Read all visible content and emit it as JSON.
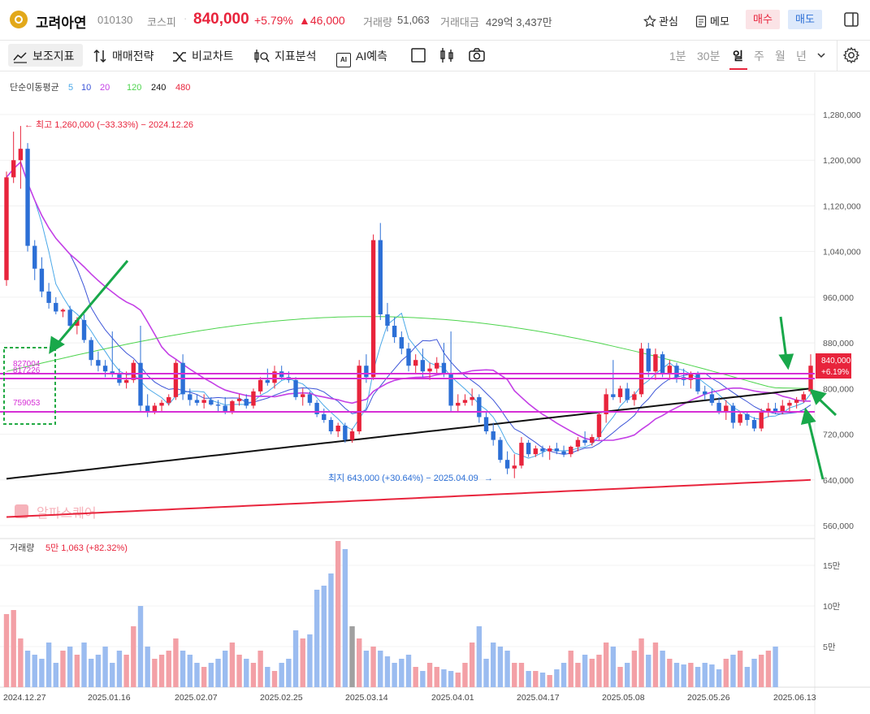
{
  "stock": {
    "name": "고려아연",
    "code": "010130",
    "market": "코스피",
    "price": "840,000",
    "change_pct": "+5.79%",
    "change_amt": "▲46,000",
    "volume_label": "거래량",
    "volume": "51,063",
    "amount_label": "거래대금",
    "amount": "429억 3,437만"
  },
  "header_actions": {
    "watch": "관심",
    "memo": "메모",
    "buy": "매수",
    "sell": "매도"
  },
  "toolbar": {
    "indicators": "보조지표",
    "strategy": "매매전략",
    "compare": "비교차트",
    "analysis": "지표분석",
    "ai": "AI예측",
    "ai_icon": "AI"
  },
  "periods": [
    "1분",
    "30분",
    "일",
    "주",
    "월",
    "년"
  ],
  "active_period": "일",
  "ma_legend": {
    "title": "단순이동평균",
    "items": [
      {
        "label": "5",
        "color": "#4aa8e8"
      },
      {
        "label": "10",
        "color": "#3d55d8"
      },
      {
        "label": "20",
        "color": "#c440e6"
      },
      {
        "label": "120",
        "color": "#4dd44d"
      },
      {
        "label": "240",
        "color": "#111111"
      },
      {
        "label": "480",
        "color": "#e8243c"
      }
    ]
  },
  "annotations": {
    "high": "최고 1,260,000 (−33.33%) − 2024.12.26",
    "low": "최지 643,000 (+30.64%) − 2025.04.09",
    "level_1": "827004",
    "level_2": "817226",
    "level_3": "759053",
    "watermark": "알파스퀘어"
  },
  "price_tag": {
    "price": "840,000",
    "change": "+6.19%"
  },
  "volume_legend": {
    "label": "거래량",
    "value": "5만 1,063 (+82.32%)"
  },
  "chart_data": {
    "type": "candlestick",
    "y_axis_ticks": [
      "1,280,000",
      "1,200,000",
      "1,120,000",
      "1,040,000",
      "960,000",
      "880,000",
      "800,000",
      "720,000",
      "640,000",
      "560,000"
    ],
    "ylim": [
      545000,
      1310000
    ],
    "volume_ticks": [
      "15만",
      "10만",
      "5만"
    ],
    "x_labels": [
      "2024.12.27",
      "2025.01.16",
      "2025.02.07",
      "2025.02.25",
      "2025.03.14",
      "2025.04.01",
      "2025.04.17",
      "2025.05.08",
      "2025.05.26",
      "2025.06.13"
    ],
    "horizontal_levels": [
      827004,
      817226,
      759053
    ],
    "ohlc": [
      [
        990000,
        1180000,
        980000,
        1170000
      ],
      [
        1170000,
        1250000,
        1160000,
        1200000
      ],
      [
        1200000,
        1260000,
        1150000,
        1220000
      ],
      [
        1220000,
        1230000,
        1040000,
        1050000
      ],
      [
        1050000,
        1060000,
        990000,
        1010000
      ],
      [
        1010000,
        1030000,
        960000,
        970000
      ],
      [
        970000,
        985000,
        940000,
        950000
      ],
      [
        950000,
        960000,
        930000,
        935000
      ],
      [
        935000,
        940000,
        925000,
        938000
      ],
      [
        938000,
        945000,
        905000,
        910000
      ],
      [
        910000,
        925000,
        895000,
        920000
      ],
      [
        920000,
        930000,
        880000,
        885000
      ],
      [
        885000,
        890000,
        840000,
        850000
      ],
      [
        850000,
        865000,
        830000,
        840000
      ],
      [
        840000,
        850000,
        820000,
        830000
      ],
      [
        830000,
        900000,
        820000,
        825000
      ],
      [
        825000,
        835000,
        805000,
        810000
      ],
      [
        810000,
        830000,
        800000,
        815000
      ],
      [
        815000,
        850000,
        810000,
        845000
      ],
      [
        845000,
        910000,
        760000,
        770000
      ],
      [
        770000,
        790000,
        750000,
        760000
      ],
      [
        760000,
        775000,
        755000,
        770000
      ],
      [
        770000,
        780000,
        760000,
        775000
      ],
      [
        775000,
        790000,
        770000,
        785000
      ],
      [
        785000,
        850000,
        780000,
        845000
      ],
      [
        845000,
        860000,
        780000,
        790000
      ],
      [
        790000,
        800000,
        770000,
        780000
      ],
      [
        780000,
        790000,
        770000,
        775000
      ],
      [
        775000,
        790000,
        765000,
        780000
      ],
      [
        780000,
        785000,
        770000,
        772000
      ],
      [
        772000,
        780000,
        760000,
        770000
      ],
      [
        770000,
        785000,
        755000,
        760000
      ],
      [
        760000,
        780000,
        755000,
        778000
      ],
      [
        778000,
        790000,
        770000,
        782000
      ],
      [
        782000,
        790000,
        765000,
        770000
      ],
      [
        770000,
        800000,
        765000,
        795000
      ],
      [
        795000,
        820000,
        790000,
        815000
      ],
      [
        815000,
        835000,
        805000,
        810000
      ],
      [
        810000,
        840000,
        800000,
        830000
      ],
      [
        830000,
        840000,
        815000,
        820000
      ],
      [
        820000,
        830000,
        810000,
        815000
      ],
      [
        815000,
        820000,
        780000,
        785000
      ],
      [
        785000,
        800000,
        770000,
        790000
      ],
      [
        790000,
        795000,
        770000,
        775000
      ],
      [
        775000,
        780000,
        750000,
        755000
      ],
      [
        755000,
        765000,
        740000,
        745000
      ],
      [
        745000,
        750000,
        720000,
        725000
      ],
      [
        725000,
        740000,
        715000,
        735000
      ],
      [
        735000,
        740000,
        705000,
        710000
      ],
      [
        710000,
        730000,
        705000,
        725000
      ],
      [
        725000,
        850000,
        720000,
        840000
      ],
      [
        840000,
        860000,
        810000,
        820000
      ],
      [
        820000,
        1070000,
        815000,
        1060000
      ],
      [
        1060000,
        1090000,
        920000,
        930000
      ],
      [
        930000,
        950000,
        900000,
        910000
      ],
      [
        910000,
        925000,
        880000,
        890000
      ],
      [
        890000,
        900000,
        860000,
        870000
      ],
      [
        870000,
        880000,
        830000,
        840000
      ],
      [
        840000,
        860000,
        825000,
        850000
      ],
      [
        850000,
        870000,
        820000,
        830000
      ],
      [
        830000,
        845000,
        815000,
        835000
      ],
      [
        835000,
        855000,
        825000,
        845000
      ],
      [
        845000,
        880000,
        820000,
        825000
      ],
      [
        825000,
        900000,
        760000,
        770000
      ],
      [
        770000,
        790000,
        760000,
        775000
      ],
      [
        775000,
        790000,
        770000,
        780000
      ],
      [
        780000,
        800000,
        770000,
        785000
      ],
      [
        785000,
        790000,
        740000,
        750000
      ],
      [
        750000,
        760000,
        720000,
        725000
      ],
      [
        725000,
        740000,
        700000,
        710000
      ],
      [
        710000,
        715000,
        670000,
        675000
      ],
      [
        675000,
        690000,
        650000,
        660000
      ],
      [
        660000,
        685000,
        643000,
        665000
      ],
      [
        665000,
        715000,
        660000,
        705000
      ],
      [
        705000,
        710000,
        680000,
        685000
      ],
      [
        685000,
        700000,
        680000,
        695000
      ],
      [
        695000,
        700000,
        680000,
        690000
      ],
      [
        690000,
        700000,
        675000,
        695000
      ],
      [
        695000,
        705000,
        685000,
        690000
      ],
      [
        690000,
        700000,
        680000,
        685000
      ],
      [
        685000,
        700000,
        680000,
        698000
      ],
      [
        698000,
        715000,
        690000,
        710000
      ],
      [
        710000,
        725000,
        700000,
        705000
      ],
      [
        705000,
        720000,
        700000,
        715000
      ],
      [
        715000,
        760000,
        710000,
        755000
      ],
      [
        755000,
        800000,
        740000,
        790000
      ],
      [
        790000,
        850000,
        780000,
        785000
      ],
      [
        785000,
        805000,
        775000,
        800000
      ],
      [
        800000,
        810000,
        775000,
        780000
      ],
      [
        780000,
        795000,
        770000,
        790000
      ],
      [
        790000,
        880000,
        785000,
        870000
      ],
      [
        870000,
        880000,
        820000,
        830000
      ],
      [
        830000,
        870000,
        815000,
        860000
      ],
      [
        860000,
        865000,
        820000,
        825000
      ],
      [
        825000,
        850000,
        815000,
        840000
      ],
      [
        840000,
        845000,
        810000,
        820000
      ],
      [
        820000,
        835000,
        805000,
        815000
      ],
      [
        815000,
        830000,
        800000,
        825000
      ],
      [
        825000,
        830000,
        790000,
        795000
      ],
      [
        795000,
        805000,
        780000,
        790000
      ],
      [
        790000,
        800000,
        770000,
        775000
      ],
      [
        775000,
        785000,
        755000,
        760000
      ],
      [
        760000,
        780000,
        745000,
        770000
      ],
      [
        770000,
        775000,
        730000,
        740000
      ],
      [
        740000,
        760000,
        735000,
        755000
      ],
      [
        755000,
        760000,
        735000,
        745000
      ],
      [
        745000,
        750000,
        725000,
        730000
      ],
      [
        730000,
        765000,
        725000,
        760000
      ],
      [
        760000,
        775000,
        750000,
        765000
      ],
      [
        765000,
        775000,
        755000,
        760000
      ],
      [
        760000,
        780000,
        755000,
        770000
      ],
      [
        770000,
        780000,
        760000,
        775000
      ],
      [
        775000,
        785000,
        765000,
        780000
      ],
      [
        780000,
        795000,
        775000,
        790000
      ],
      [
        795000,
        860000,
        790000,
        840000
      ]
    ],
    "volume": [
      90,
      95,
      60,
      45,
      40,
      35,
      55,
      30,
      45,
      50,
      40,
      55,
      35,
      40,
      50,
      30,
      45,
      40,
      75,
      100,
      50,
      35,
      40,
      45,
      60,
      45,
      40,
      30,
      25,
      30,
      35,
      45,
      55,
      40,
      35,
      30,
      45,
      25,
      20,
      30,
      35,
      70,
      60,
      65,
      120,
      125,
      140,
      180,
      170,
      75,
      60,
      45,
      50,
      45,
      38,
      30,
      35,
      40,
      25,
      20,
      30,
      25,
      22,
      20,
      18,
      30,
      55,
      75,
      35,
      55,
      50,
      45,
      30,
      30,
      20,
      20,
      18,
      15,
      22,
      30,
      45,
      30,
      40,
      35,
      40,
      55,
      50,
      25,
      30,
      45,
      60,
      40,
      55,
      45,
      35,
      30,
      28,
      30,
      25,
      30,
      28,
      22,
      35,
      40,
      45,
      25,
      35,
      40,
      45,
      50
    ],
    "volume_unit": "천"
  }
}
